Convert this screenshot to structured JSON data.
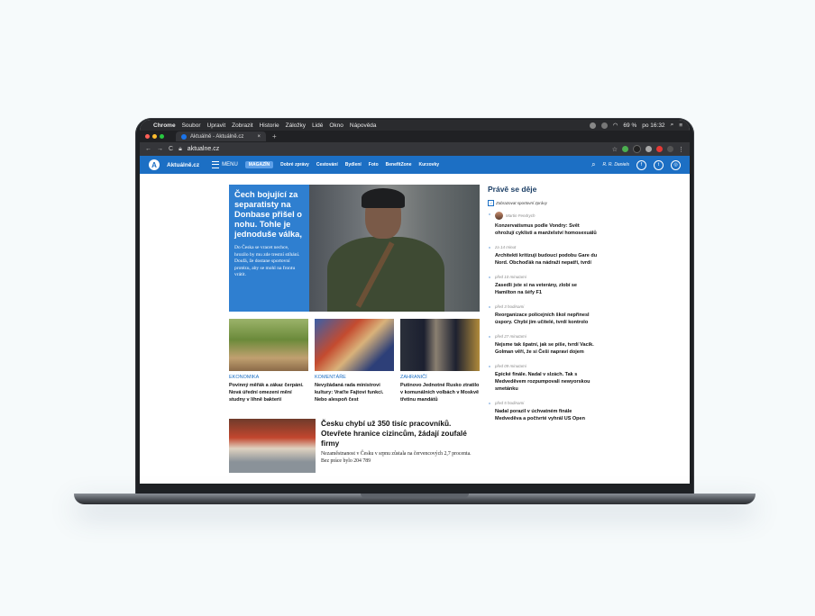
{
  "menubar": {
    "app": "Chrome",
    "items": [
      "Soubor",
      "Upravit",
      "Zobrazit",
      "Historie",
      "Záložky",
      "Lidé",
      "Okno",
      "Nápověda"
    ],
    "battery": "69 %",
    "clock": "po 16:32"
  },
  "browser": {
    "tab_title": "Aktuálně - Aktuálně.cz",
    "url": "aktualne.cz"
  },
  "site": {
    "brand": "Aktuálně.cz",
    "menu_label": "MENU",
    "nav": [
      "MAGAZÍN",
      "Dobré zprávy",
      "Cestování",
      "Bydlení",
      "Foto",
      "BenefitZone",
      "Kurzovky"
    ],
    "user": "R. R. Daniels"
  },
  "hero": {
    "title": "Čech bojující za separatisty na Donbase přišel o nohu. Tohle je jednoduše válka,",
    "desc": "Do Česka se vracet nechce, hrozilo by mu zde trestní stíhání. Doufá, že dostane sportovní protézu, aby se mohl na frontu vrátit."
  },
  "cards": [
    {
      "category": "EKONOMIKA",
      "title": "Povinný měřák a zákaz čerpání. Nová úřední omezení mění studny v líhně bakterií"
    },
    {
      "category": "KOMENTÁŘE",
      "title": "Nevyžádaná rada ministrovi kultury: Vraťte Fajtovi funkci. Nebo alespoň čest"
    },
    {
      "category": "ZAHRANIČÍ",
      "title": "Putinovo Jednotné Rusko ztratilo v komunálních volbách v Moskvě třetinu mandátů"
    }
  ],
  "bottom_story": {
    "title": "Česku chybí už 350 tisíc pracovníků. Otevřete hranice cizincům, žádají zoufalé firmy",
    "desc": "Nezaměstnanost v Česku v srpnu zůstala na červencových 2,7 procenta. Bez práce bylo 204 789"
  },
  "sidebar": {
    "title": "Právě se děje",
    "checkbox_label": "Zobrazovat sportovní zprávy",
    "items": [
      {
        "meta": "Martin Fendrych",
        "title": "Konzervatismus podle Vondry: Svět ohrožují cyklisti a manželství homosexuálů"
      },
      {
        "meta": "za 14 minut",
        "title": "Architekti kritizují budoucí podobu Gare du Nord. Obchoďák na nádraží nepatří, tvrdí"
      },
      {
        "meta": "před 10 minutami",
        "title": "Zasedli jste si na veterány, zlobí se Hamilton na šéfy F1"
      },
      {
        "meta": "před 3 hodinami",
        "title": "Reorganizace policejních škol nepřinesl úspory. Chybí jim učitelé, tvrdí kontrolo"
      },
      {
        "meta": "před 27 minutami",
        "title": "Nejsme tak špatní, jak se píše, tvrdí Vacík. Golman věří, že si Češi napraví dojem"
      },
      {
        "meta": "před 09 minutami",
        "title": "Epické finále. Nadal v slzách. Tak s Medveděvem rozpumpovali newyorskou smetánku"
      },
      {
        "meta": "před 5 hodinami",
        "title": "Nadal porazil v úchvatném finále Medveděva a počtvrté vyhrál US Open"
      }
    ]
  }
}
